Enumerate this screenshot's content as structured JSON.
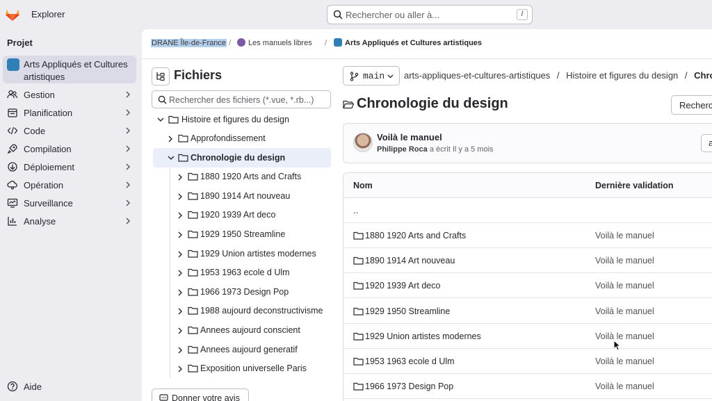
{
  "topbar": {
    "explore_label": "Explorer",
    "search_placeholder": "Rechercher ou aller à...",
    "search_shortcut": "/"
  },
  "sidebar": {
    "section_title": "Projet",
    "project_name": "Arts Appliqués et Cultures artistiques",
    "items": [
      {
        "label": "Gestion",
        "icon": "users-icon"
      },
      {
        "label": "Planification",
        "icon": "calendar-icon"
      },
      {
        "label": "Code",
        "icon": "code-icon"
      },
      {
        "label": "Compilation",
        "icon": "rocket-icon"
      },
      {
        "label": "Déploiement",
        "icon": "deploy-icon"
      },
      {
        "label": "Opération",
        "icon": "cloud-gear-icon"
      },
      {
        "label": "Surveillance",
        "icon": "monitor-icon"
      },
      {
        "label": "Analyse",
        "icon": "chart-icon"
      }
    ],
    "help_label": "Aide"
  },
  "breadcrumb": {
    "group": "DRANE Île-de-France",
    "subgroup": "Les manuels libres",
    "project": "Arts Appliqués et Cultures artistiques"
  },
  "filetree": {
    "title": "Fichiers",
    "search_placeholder": "Rechercher des fichiers (*.vue, *.rb...)",
    "root": "Histoire et figures du design",
    "items": [
      {
        "label": "Approfondissement",
        "level": 1,
        "expanded": false,
        "selected": false
      },
      {
        "label": "Chronologie du design",
        "level": 1,
        "expanded": true,
        "selected": true
      },
      {
        "label": "1880 1920 Arts and Crafts",
        "level": 2
      },
      {
        "label": "1890 1914 Art nouveau",
        "level": 2
      },
      {
        "label": "1920 1939 Art deco",
        "level": 2
      },
      {
        "label": "1929 1950 Streamline",
        "level": 2
      },
      {
        "label": "1929 Union artistes modernes",
        "level": 2
      },
      {
        "label": "1953 1963 ecole d Ulm",
        "level": 2
      },
      {
        "label": "1966 1973 Design Pop",
        "level": 2
      },
      {
        "label": "1988 aujourd deconstructivisme",
        "level": 2
      },
      {
        "label": "Annees aujourd conscient",
        "level": 2
      },
      {
        "label": "Annees aujourd generatif",
        "level": 2
      },
      {
        "label": "Exposition universelle Paris",
        "level": 2
      }
    ],
    "feedback_label": "Donner votre avis"
  },
  "repo": {
    "branch": "main",
    "path": [
      "arts-appliques-et-cultures-artistiques",
      "/",
      "Histoire et figures du design",
      "/",
      "Chron"
    ],
    "title": "Chronologie du design",
    "search_button": "Recherc",
    "commit": {
      "message": "Voilà le manuel",
      "author": "Philippe Roca",
      "action": "a écrit",
      "time": "Il y a 5 mois",
      "button": "a"
    },
    "table": {
      "headers": [
        "Nom",
        "Dernière validation"
      ],
      "parent": "..",
      "rows": [
        {
          "name": "1880 1920 Arts and Crafts",
          "commit": "Voilà le manuel"
        },
        {
          "name": "1890 1914 Art nouveau",
          "commit": "Voilà le manuel"
        },
        {
          "name": "1920 1939 Art deco",
          "commit": "Voilà le manuel"
        },
        {
          "name": "1929 1950 Streamline",
          "commit": "Voilà le manuel"
        },
        {
          "name": "1929 Union artistes modernes",
          "commit": "Voilà le manuel"
        },
        {
          "name": "1953 1963 ecole d Ulm",
          "commit": "Voilà le manuel"
        },
        {
          "name": "1966 1973 Design Pop",
          "commit": "Voilà le manuel"
        }
      ]
    }
  },
  "colors": {
    "accent_logo": "#e24329",
    "selected_bg": "#dbdbe8",
    "tree_selected_bg": "#e9eef8",
    "page_bg": "#ececf1"
  }
}
